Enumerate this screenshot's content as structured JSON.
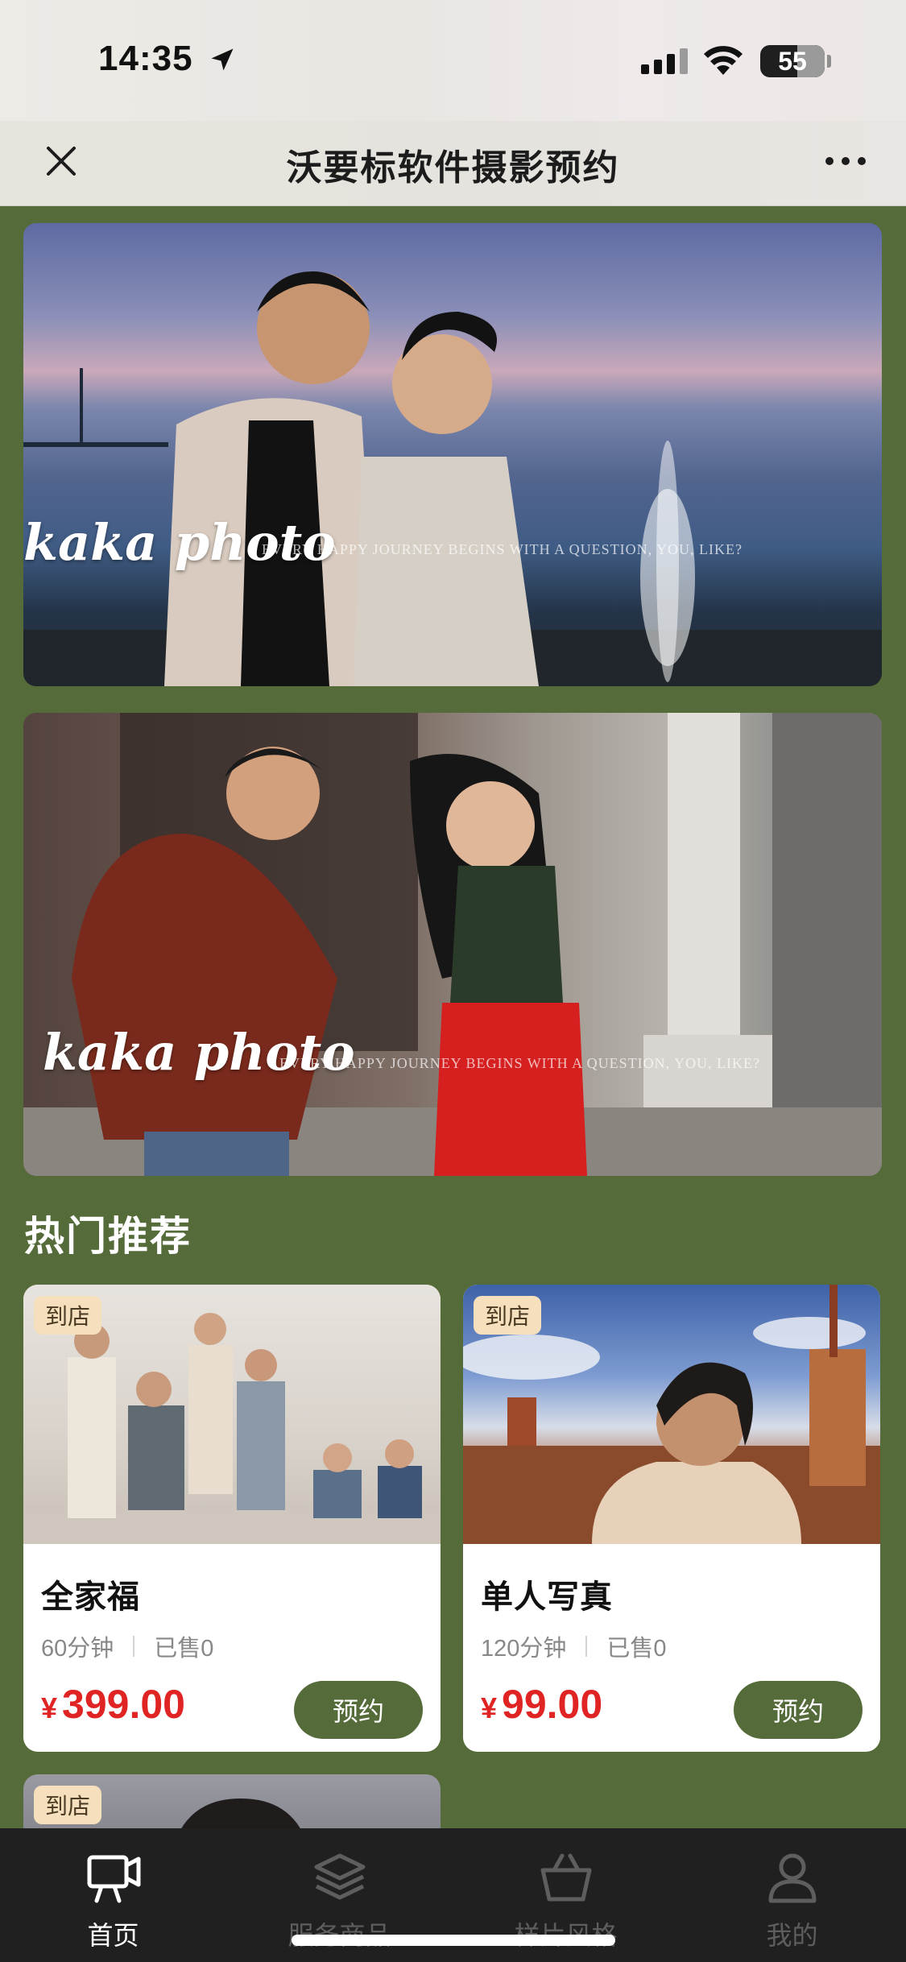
{
  "status_bar": {
    "time": "14:35",
    "battery": "55",
    "icons": [
      "location-arrow-icon",
      "signal-icon",
      "wifi-icon",
      "battery-icon"
    ]
  },
  "nav": {
    "title": "沃要标软件摄影预约",
    "close_icon": "close-icon",
    "more_icon": "more-icon"
  },
  "banners": [
    {
      "label": "kaka photo",
      "sub": "EVERY HAPPY JOURNEY BEGINS WITH A QUESTION, YOU, LIKE?"
    },
    {
      "label": "kaka photo",
      "sub": "EVERY HAPPY JOURNEY BEGINS WITH A QUESTION, YOU, LIKE?"
    }
  ],
  "section": {
    "title": "热门推荐"
  },
  "products": [
    {
      "tag": "到店",
      "name": "全家福",
      "duration": "60分钟",
      "sold": "已售0",
      "currency": "¥",
      "price": "399.00",
      "button": "预约"
    },
    {
      "tag": "到店",
      "name": "单人写真",
      "duration": "120分钟",
      "sold": "已售0",
      "currency": "¥",
      "price": "99.00",
      "button": "预约"
    },
    {
      "tag": "到店"
    }
  ],
  "tabbar": {
    "items": [
      {
        "label": "首页",
        "icon": "home-camera-icon",
        "active": true
      },
      {
        "label": "服务商品",
        "icon": "layers-icon",
        "active": false
      },
      {
        "label": "样片风格",
        "icon": "basket-icon",
        "active": false
      },
      {
        "label": "我的",
        "icon": "user-icon",
        "active": false
      }
    ]
  },
  "colors": {
    "theme_green": "#556b3a",
    "price_red": "#e02424",
    "tag_bg": "#f5dfbd",
    "tabbar_bg": "#202020"
  }
}
